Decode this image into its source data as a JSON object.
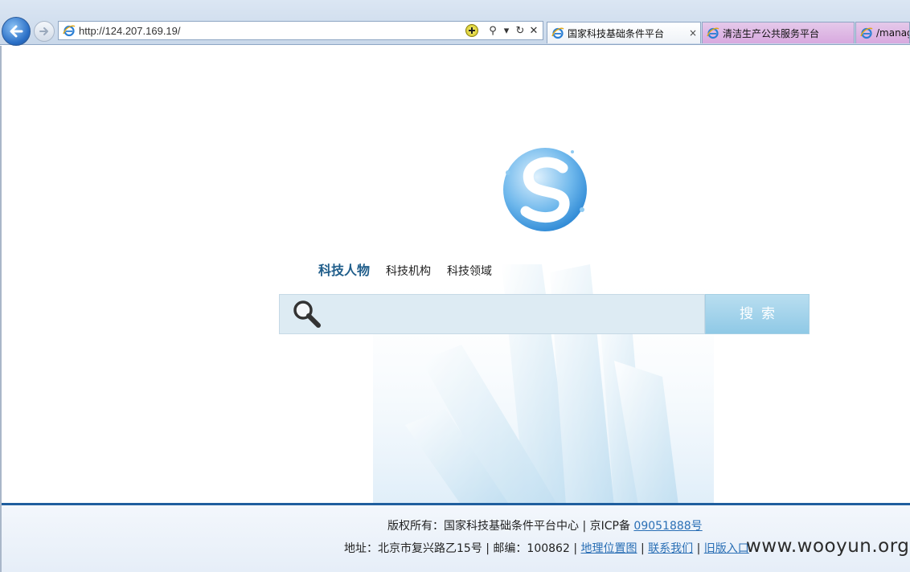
{
  "browser": {
    "address_url": "http://124.207.169.19/",
    "tabs": [
      {
        "label": "国家科技基础条件平台",
        "active": true,
        "close": "×"
      },
      {
        "label": "清洁生产公共服务平台",
        "active": false
      },
      {
        "label": "/manag",
        "active": false
      }
    ],
    "tool_glyphs": {
      "search": "⚲",
      "dropdown": "▾",
      "refresh": "↻",
      "stop": "✕"
    }
  },
  "page": {
    "nav": {
      "items": [
        "科技人物",
        "科技机构",
        "科技领域"
      ],
      "active_index": 0
    },
    "search": {
      "placeholder": "",
      "value": "",
      "button_label": "搜索"
    },
    "footer": {
      "copyright_prefix": "版权所有：国家科技基础条件平台中心 | 京ICP备",
      "icp_number": "09051888号",
      "address_prefix": "地址：北京市复兴路乙15号 | 邮编：100862 |",
      "links": [
        "地理位置图",
        "联系我们",
        "旧版入口"
      ],
      "separator": "|"
    },
    "watermark": "www.wooyun.org"
  },
  "colors": {
    "nav_active": "#1f5d8a",
    "link": "#2a6fb5",
    "footer_rule": "#1f5e9e",
    "search_button": "#8fc9e6"
  }
}
